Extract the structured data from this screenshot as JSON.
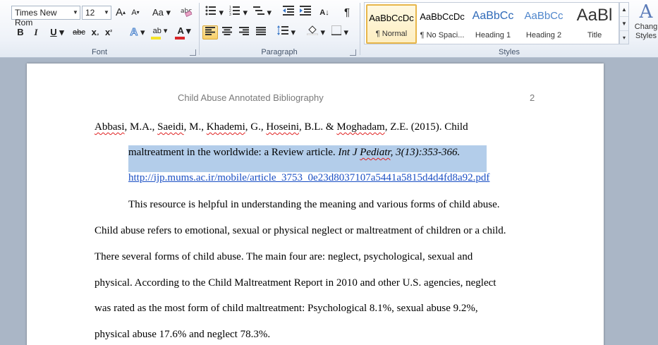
{
  "ribbon": {
    "font": {
      "name_value": "Times New Rom",
      "size_value": "12",
      "grow_glyph": "A",
      "shrink_glyph": "A",
      "case_glyph": "Aa",
      "bold": "B",
      "italic": "I",
      "underline": "U",
      "strike": "abc",
      "subscript": "x",
      "superscript": "x",
      "text_effect_glyph": "A",
      "highlight_glyph": "ab",
      "font_color_glyph": "A",
      "label": "Font",
      "highlight_color": "#f5e42a",
      "font_color": "#d8262a"
    },
    "paragraph": {
      "sort_glyph": "A↓",
      "pilcrow": "¶",
      "label": "Paragraph"
    },
    "styles": {
      "label": "Styles",
      "items": [
        {
          "sample": "AaBbCcDc",
          "name": "¶ Normal",
          "selected": true
        },
        {
          "sample": "AaBbCcDc",
          "name": "¶ No Spaci..."
        },
        {
          "sample": "AaBbCc",
          "name": "Heading 1"
        },
        {
          "sample": "AaBbCc",
          "name": "Heading 2"
        },
        {
          "sample": "AaBl",
          "name": "Title"
        }
      ],
      "change_styles_glyph": "A",
      "change_styles_line1": "Chang",
      "change_styles_line2": "Styles"
    }
  },
  "document": {
    "header_title": "Child Abuse Annotated Bibliography",
    "page_number": "2",
    "citation": {
      "line1": {
        "author1": "Abbasi",
        "p1": ", M.A., ",
        "author2": "Saeidi",
        "p2": ", M., ",
        "author3": "Khademi",
        "p3": ", G., ",
        "author4": "Hoseini",
        "p4": ", B.L. & ",
        "author5": "Moghadam",
        "p5": ", Z.E. (2015). Child"
      },
      "line2": {
        "title": "maltreatment in the worldwide: a Review article. ",
        "journal_a": "Int J ",
        "journal_b": "Pediatr",
        "journal_c": ", 3(13):353-366."
      },
      "url": "http://ijp.mums.ac.ir/mobile/article_3753_0e23d8037107a5441a5815d4d4fd8a92.pdf"
    },
    "annotation_lines": [
      "This resource is helpful in understanding the meaning  and various forms of child abuse.",
      "Child abuse refers to emotional, sexual or physical neglect or maltreatment of children or a child.",
      "There several  forms of child abuse. The main four are: neglect, psychological, sexual and",
      "physical. According to the Child Maltreatment Report in 2010 and other U.S. agencies, neglect",
      "was rated as the most form of child maltreatment: Psychological  8.1%, sexual abuse 9.2%,",
      "physical abuse 17.6% and neglect 78.3%."
    ]
  }
}
